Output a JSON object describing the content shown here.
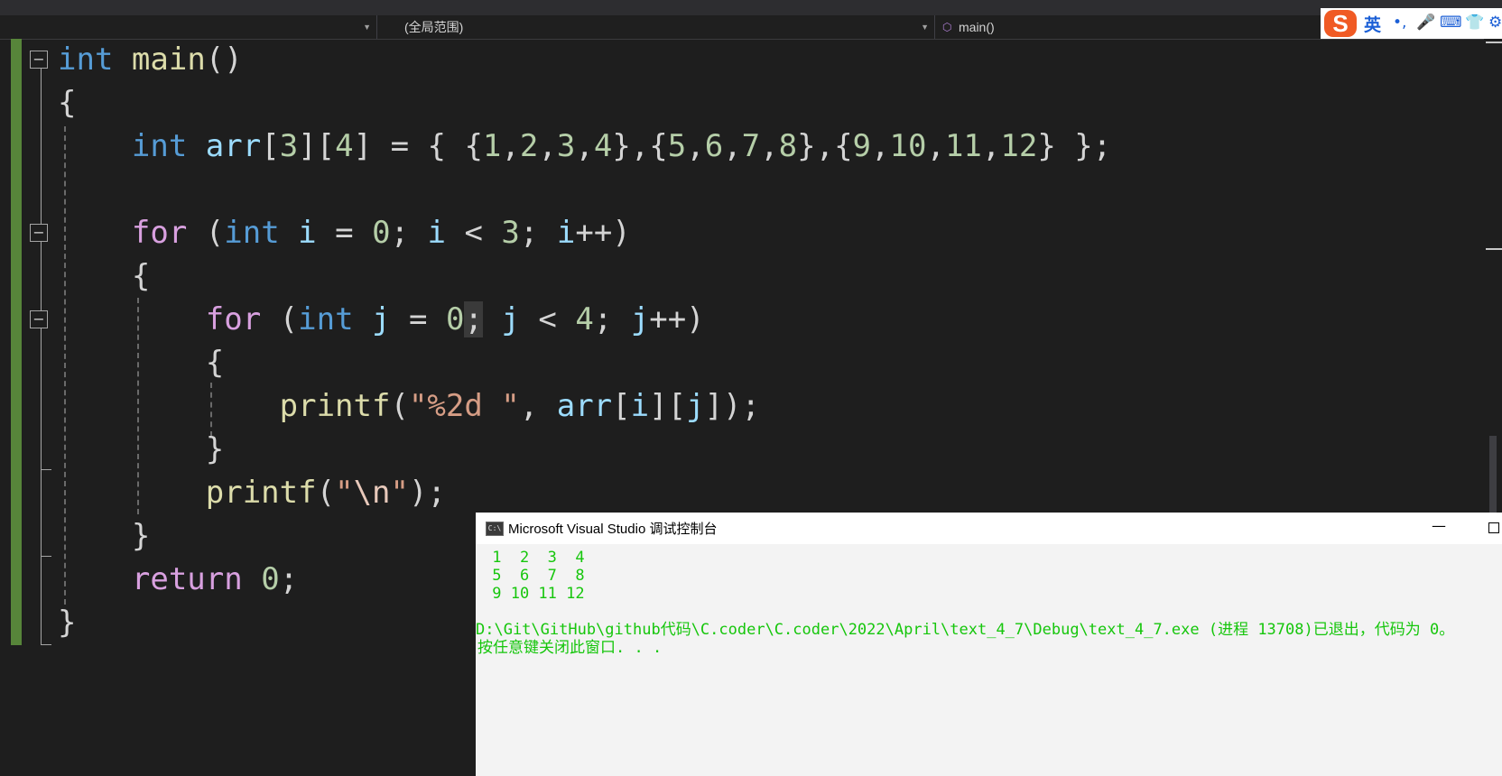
{
  "navbar": {
    "left_scope": "",
    "scope": "(全局范围)",
    "function": "main()"
  },
  "ime": {
    "lang": "英",
    "icons": [
      "sogou-logo-icon",
      "punctuation-icon",
      "microphone-icon",
      "keyboard-icon",
      "skin-icon",
      "settings-icon"
    ]
  },
  "code": [
    [
      {
        "t": "int",
        "c": "kw"
      },
      {
        "t": " "
      },
      {
        "t": "main",
        "c": "fn"
      },
      {
        "t": "()"
      }
    ],
    [
      {
        "t": "{"
      }
    ],
    [
      {
        "t": "    "
      },
      {
        "t": "int",
        "c": "kw"
      },
      {
        "t": " "
      },
      {
        "t": "arr",
        "c": "var"
      },
      {
        "t": "["
      },
      {
        "t": "3",
        "c": "num"
      },
      {
        "t": "]["
      },
      {
        "t": "4",
        "c": "num"
      },
      {
        "t": "] = { {"
      },
      {
        "t": "1",
        "c": "num"
      },
      {
        "t": ","
      },
      {
        "t": "2",
        "c": "num"
      },
      {
        "t": ","
      },
      {
        "t": "3",
        "c": "num"
      },
      {
        "t": ","
      },
      {
        "t": "4",
        "c": "num"
      },
      {
        "t": "},{"
      },
      {
        "t": "5",
        "c": "num"
      },
      {
        "t": ","
      },
      {
        "t": "6",
        "c": "num"
      },
      {
        "t": ","
      },
      {
        "t": "7",
        "c": "num"
      },
      {
        "t": ","
      },
      {
        "t": "8",
        "c": "num"
      },
      {
        "t": "},{"
      },
      {
        "t": "9",
        "c": "num"
      },
      {
        "t": ","
      },
      {
        "t": "10",
        "c": "num"
      },
      {
        "t": ","
      },
      {
        "t": "11",
        "c": "num"
      },
      {
        "t": ","
      },
      {
        "t": "12",
        "c": "num"
      },
      {
        "t": "} };"
      }
    ],
    [
      {
        "t": ""
      }
    ],
    [
      {
        "t": "    "
      },
      {
        "t": "for",
        "c": "ctl"
      },
      {
        "t": " ("
      },
      {
        "t": "int",
        "c": "kw"
      },
      {
        "t": " "
      },
      {
        "t": "i",
        "c": "var"
      },
      {
        "t": " = "
      },
      {
        "t": "0",
        "c": "num"
      },
      {
        "t": "; "
      },
      {
        "t": "i",
        "c": "var"
      },
      {
        "t": " < "
      },
      {
        "t": "3",
        "c": "num"
      },
      {
        "t": "; "
      },
      {
        "t": "i",
        "c": "var"
      },
      {
        "t": "++)"
      }
    ],
    [
      {
        "t": "    {"
      }
    ],
    [
      {
        "t": "        "
      },
      {
        "t": "for",
        "c": "ctl"
      },
      {
        "t": " ("
      },
      {
        "t": "int",
        "c": "kw"
      },
      {
        "t": " "
      },
      {
        "t": "j",
        "c": "var"
      },
      {
        "t": " = "
      },
      {
        "t": "0",
        "c": "num"
      },
      {
        "t": ";",
        "c": "caret-mark"
      },
      {
        "t": " "
      },
      {
        "t": "j",
        "c": "var"
      },
      {
        "t": " < "
      },
      {
        "t": "4",
        "c": "num"
      },
      {
        "t": "; "
      },
      {
        "t": "j",
        "c": "var"
      },
      {
        "t": "++)"
      }
    ],
    [
      {
        "t": "        {"
      }
    ],
    [
      {
        "t": "            "
      },
      {
        "t": "printf",
        "c": "fn"
      },
      {
        "t": "("
      },
      {
        "t": "\"%2d \"",
        "c": "str"
      },
      {
        "t": ", "
      },
      {
        "t": "arr",
        "c": "var"
      },
      {
        "t": "["
      },
      {
        "t": "i",
        "c": "var"
      },
      {
        "t": "]["
      },
      {
        "t": "j",
        "c": "var"
      },
      {
        "t": "]);"
      }
    ],
    [
      {
        "t": "        }"
      }
    ],
    [
      {
        "t": "        "
      },
      {
        "t": "printf",
        "c": "fn"
      },
      {
        "t": "("
      },
      {
        "t": "\"",
        "c": "str"
      },
      {
        "t": "\\n",
        "c": "esc"
      },
      {
        "t": "\"",
        "c": "str"
      },
      {
        "t": ");"
      }
    ],
    [
      {
        "t": "    }"
      }
    ],
    [
      {
        "t": "    "
      },
      {
        "t": "return",
        "c": "ctl"
      },
      {
        "t": " "
      },
      {
        "t": "0",
        "c": "num"
      },
      {
        "t": ";"
      }
    ],
    [
      {
        "t": "}"
      }
    ]
  ],
  "console": {
    "title": "Microsoft Visual Studio 调试控制台",
    "icon_label": "C:\\",
    "lines": [
      " 1  2  3  4",
      " 5  6  7  8",
      " 9 10 11 12",
      "",
      "D:\\Git\\GitHub\\github代码\\C.coder\\C.coder\\2022\\April\\text_4_7\\Debug\\text_4_7.exe (进程 13708)已退出，代码为 0。",
      "按任意键关闭此窗口. . ."
    ]
  },
  "colors": {
    "editor_bg": "#1e1e1e",
    "keyword": "#569cd6",
    "control": "#d8a0df",
    "function": "#dcdcaa",
    "variable": "#9cdcfe",
    "number": "#b5cea8",
    "string": "#d69d85",
    "console_text": "#16c60c",
    "change_bar": "#57853a"
  }
}
